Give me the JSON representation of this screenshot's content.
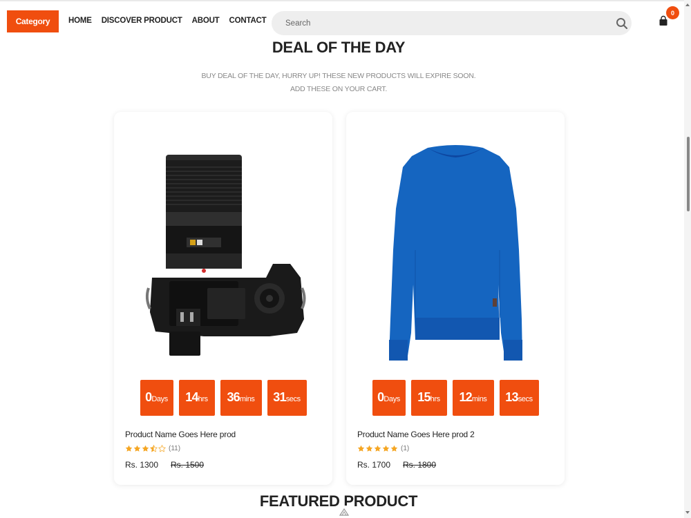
{
  "header": {
    "category_label": "Category",
    "nav": [
      "HOME",
      "DISCOVER PRODUCT",
      "ABOUT",
      "CONTACT"
    ],
    "search_placeholder": "Search",
    "cart_count": "0",
    "icons": {
      "search": "search-icon",
      "cart": "shopping-bag-icon"
    }
  },
  "deal": {
    "title": "DEAL OF THE DAY",
    "subtitle_line1": "BUY DEAL OF THE DAY, HURRY UP! THESE NEW PRODUCTS WILL EXPIRE SOON.",
    "subtitle_line2": "ADD THESE ON YOUR CART."
  },
  "products": [
    {
      "name": "Product Name Goes Here prod",
      "rating": 3.5,
      "rating_count": "(11)",
      "price": "Rs. 1300",
      "old_price": "Rs. 1500",
      "image": "camera",
      "countdown": [
        {
          "value": "0",
          "unit": "Days"
        },
        {
          "value": "14",
          "unit": "hrs"
        },
        {
          "value": "36",
          "unit": "mins"
        },
        {
          "value": "31",
          "unit": "secs"
        }
      ]
    },
    {
      "name": "Product Name Goes Here prod 2",
      "rating": 5,
      "rating_count": "(1)",
      "price": "Rs. 1700",
      "old_price": "Rs. 1800",
      "image": "blue-sweater",
      "countdown": [
        {
          "value": "0",
          "unit": "Days"
        },
        {
          "value": "15",
          "unit": "hrs"
        },
        {
          "value": "12",
          "unit": "mins"
        },
        {
          "value": "13",
          "unit": "secs"
        }
      ]
    }
  ],
  "featured_title": "FEATURED PRODUCT",
  "colors": {
    "accent": "#f04e0f",
    "star": "#f5a623",
    "sweater": "#1565c0"
  }
}
